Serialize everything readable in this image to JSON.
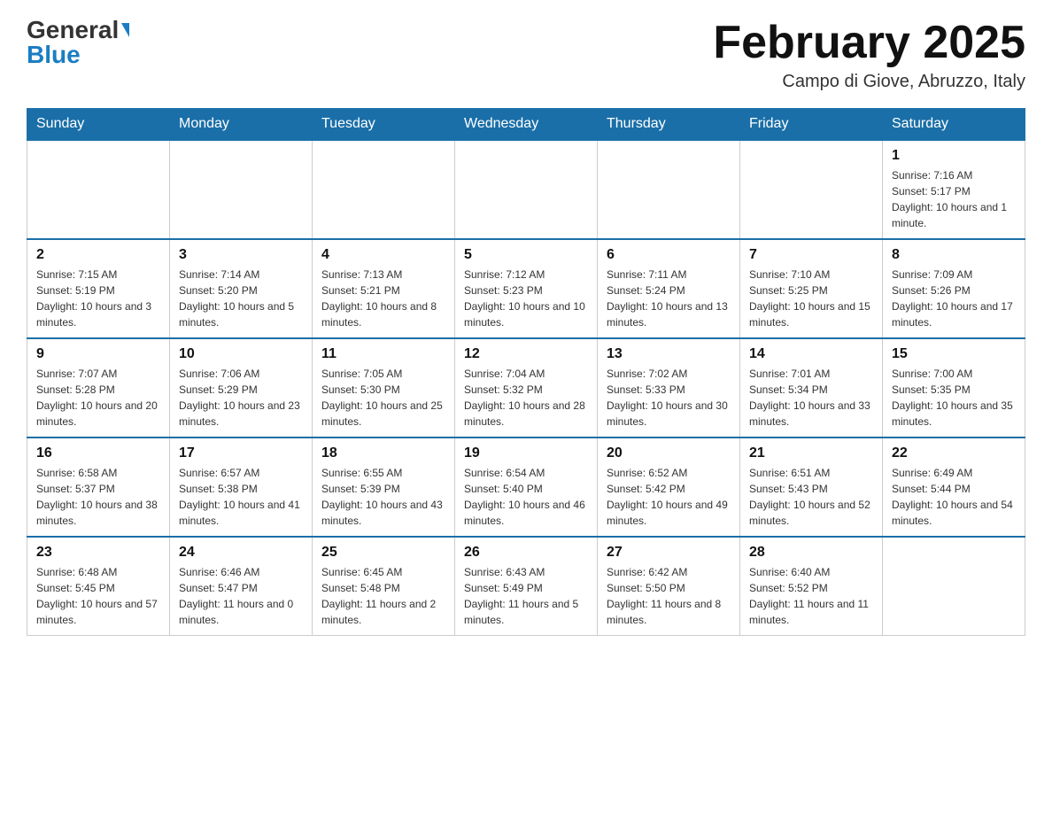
{
  "header": {
    "logo_general": "General",
    "logo_blue": "Blue",
    "month_title": "February 2025",
    "location": "Campo di Giove, Abruzzo, Italy"
  },
  "days_of_week": [
    "Sunday",
    "Monday",
    "Tuesday",
    "Wednesday",
    "Thursday",
    "Friday",
    "Saturday"
  ],
  "weeks": [
    [
      {
        "day": "",
        "info": ""
      },
      {
        "day": "",
        "info": ""
      },
      {
        "day": "",
        "info": ""
      },
      {
        "day": "",
        "info": ""
      },
      {
        "day": "",
        "info": ""
      },
      {
        "day": "",
        "info": ""
      },
      {
        "day": "1",
        "info": "Sunrise: 7:16 AM\nSunset: 5:17 PM\nDaylight: 10 hours and 1 minute."
      }
    ],
    [
      {
        "day": "2",
        "info": "Sunrise: 7:15 AM\nSunset: 5:19 PM\nDaylight: 10 hours and 3 minutes."
      },
      {
        "day": "3",
        "info": "Sunrise: 7:14 AM\nSunset: 5:20 PM\nDaylight: 10 hours and 5 minutes."
      },
      {
        "day": "4",
        "info": "Sunrise: 7:13 AM\nSunset: 5:21 PM\nDaylight: 10 hours and 8 minutes."
      },
      {
        "day": "5",
        "info": "Sunrise: 7:12 AM\nSunset: 5:23 PM\nDaylight: 10 hours and 10 minutes."
      },
      {
        "day": "6",
        "info": "Sunrise: 7:11 AM\nSunset: 5:24 PM\nDaylight: 10 hours and 13 minutes."
      },
      {
        "day": "7",
        "info": "Sunrise: 7:10 AM\nSunset: 5:25 PM\nDaylight: 10 hours and 15 minutes."
      },
      {
        "day": "8",
        "info": "Sunrise: 7:09 AM\nSunset: 5:26 PM\nDaylight: 10 hours and 17 minutes."
      }
    ],
    [
      {
        "day": "9",
        "info": "Sunrise: 7:07 AM\nSunset: 5:28 PM\nDaylight: 10 hours and 20 minutes."
      },
      {
        "day": "10",
        "info": "Sunrise: 7:06 AM\nSunset: 5:29 PM\nDaylight: 10 hours and 23 minutes."
      },
      {
        "day": "11",
        "info": "Sunrise: 7:05 AM\nSunset: 5:30 PM\nDaylight: 10 hours and 25 minutes."
      },
      {
        "day": "12",
        "info": "Sunrise: 7:04 AM\nSunset: 5:32 PM\nDaylight: 10 hours and 28 minutes."
      },
      {
        "day": "13",
        "info": "Sunrise: 7:02 AM\nSunset: 5:33 PM\nDaylight: 10 hours and 30 minutes."
      },
      {
        "day": "14",
        "info": "Sunrise: 7:01 AM\nSunset: 5:34 PM\nDaylight: 10 hours and 33 minutes."
      },
      {
        "day": "15",
        "info": "Sunrise: 7:00 AM\nSunset: 5:35 PM\nDaylight: 10 hours and 35 minutes."
      }
    ],
    [
      {
        "day": "16",
        "info": "Sunrise: 6:58 AM\nSunset: 5:37 PM\nDaylight: 10 hours and 38 minutes."
      },
      {
        "day": "17",
        "info": "Sunrise: 6:57 AM\nSunset: 5:38 PM\nDaylight: 10 hours and 41 minutes."
      },
      {
        "day": "18",
        "info": "Sunrise: 6:55 AM\nSunset: 5:39 PM\nDaylight: 10 hours and 43 minutes."
      },
      {
        "day": "19",
        "info": "Sunrise: 6:54 AM\nSunset: 5:40 PM\nDaylight: 10 hours and 46 minutes."
      },
      {
        "day": "20",
        "info": "Sunrise: 6:52 AM\nSunset: 5:42 PM\nDaylight: 10 hours and 49 minutes."
      },
      {
        "day": "21",
        "info": "Sunrise: 6:51 AM\nSunset: 5:43 PM\nDaylight: 10 hours and 52 minutes."
      },
      {
        "day": "22",
        "info": "Sunrise: 6:49 AM\nSunset: 5:44 PM\nDaylight: 10 hours and 54 minutes."
      }
    ],
    [
      {
        "day": "23",
        "info": "Sunrise: 6:48 AM\nSunset: 5:45 PM\nDaylight: 10 hours and 57 minutes."
      },
      {
        "day": "24",
        "info": "Sunrise: 6:46 AM\nSunset: 5:47 PM\nDaylight: 11 hours and 0 minutes."
      },
      {
        "day": "25",
        "info": "Sunrise: 6:45 AM\nSunset: 5:48 PM\nDaylight: 11 hours and 2 minutes."
      },
      {
        "day": "26",
        "info": "Sunrise: 6:43 AM\nSunset: 5:49 PM\nDaylight: 11 hours and 5 minutes."
      },
      {
        "day": "27",
        "info": "Sunrise: 6:42 AM\nSunset: 5:50 PM\nDaylight: 11 hours and 8 minutes."
      },
      {
        "day": "28",
        "info": "Sunrise: 6:40 AM\nSunset: 5:52 PM\nDaylight: 11 hours and 11 minutes."
      },
      {
        "day": "",
        "info": ""
      }
    ]
  ]
}
